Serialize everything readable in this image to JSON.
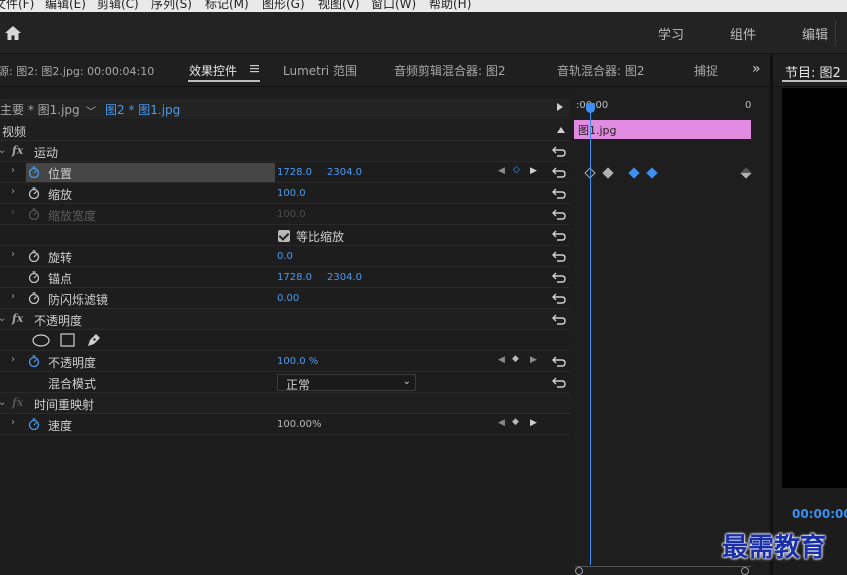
{
  "menu": [
    "文件(F)",
    "编辑(E)",
    "剪辑(C)",
    "序列(S)",
    "标记(M)",
    "图形(G)",
    "视图(V)",
    "窗口(W)",
    "帮助(H)"
  ],
  "workspaces": [
    "学习",
    "组件",
    "编辑"
  ],
  "tabs": {
    "source": "源: 图2: 图2.jpg: 00:00:04:10",
    "effect_controls": "效果控件",
    "lumetri": "Lumetri 范围",
    "audio_clip_mixer": "音频剪辑混合器: 图2",
    "audio_track_mixer": "音轨混合器: 图2",
    "capture": "捕捉",
    "more": "»",
    "program": "节目: 图2"
  },
  "clip": {
    "main": "主要 * 图1.jpg",
    "sequence_clip": "图2 * 图1.jpg",
    "video_label": "视频"
  },
  "timeline": {
    "ruler_start": ":00:00",
    "ruler_end": "0",
    "clip_label": "图1.jpg"
  },
  "effects": {
    "motion": "运动",
    "position": {
      "label": "位置",
      "x": "1728.0",
      "y": "2304.0"
    },
    "scale": {
      "label": "缩放",
      "value": "100.0"
    },
    "scale_width": {
      "label": "缩放宽度",
      "value": "100.0"
    },
    "uniform_scale": "等比缩放",
    "rotation": {
      "label": "旋转",
      "value": "0.0"
    },
    "anchor": {
      "label": "锚点",
      "x": "1728.0",
      "y": "2304.0"
    },
    "anti_flicker": {
      "label": "防闪烁滤镜",
      "value": "0.00"
    },
    "opacity_section": "不透明度",
    "opacity": {
      "label": "不透明度",
      "value": "100.0 %"
    },
    "blend_mode": {
      "label": "混合模式",
      "value": "正常"
    },
    "time_remap": "时间重映射",
    "speed": {
      "label": "速度",
      "value": "100.00%"
    }
  },
  "program": {
    "timecode": "00:00:00"
  },
  "watermark": "最需教育",
  "colors": {
    "accent": "#3b8ff0",
    "clip": "#e08ae0",
    "panel": "#1d1d1d"
  }
}
